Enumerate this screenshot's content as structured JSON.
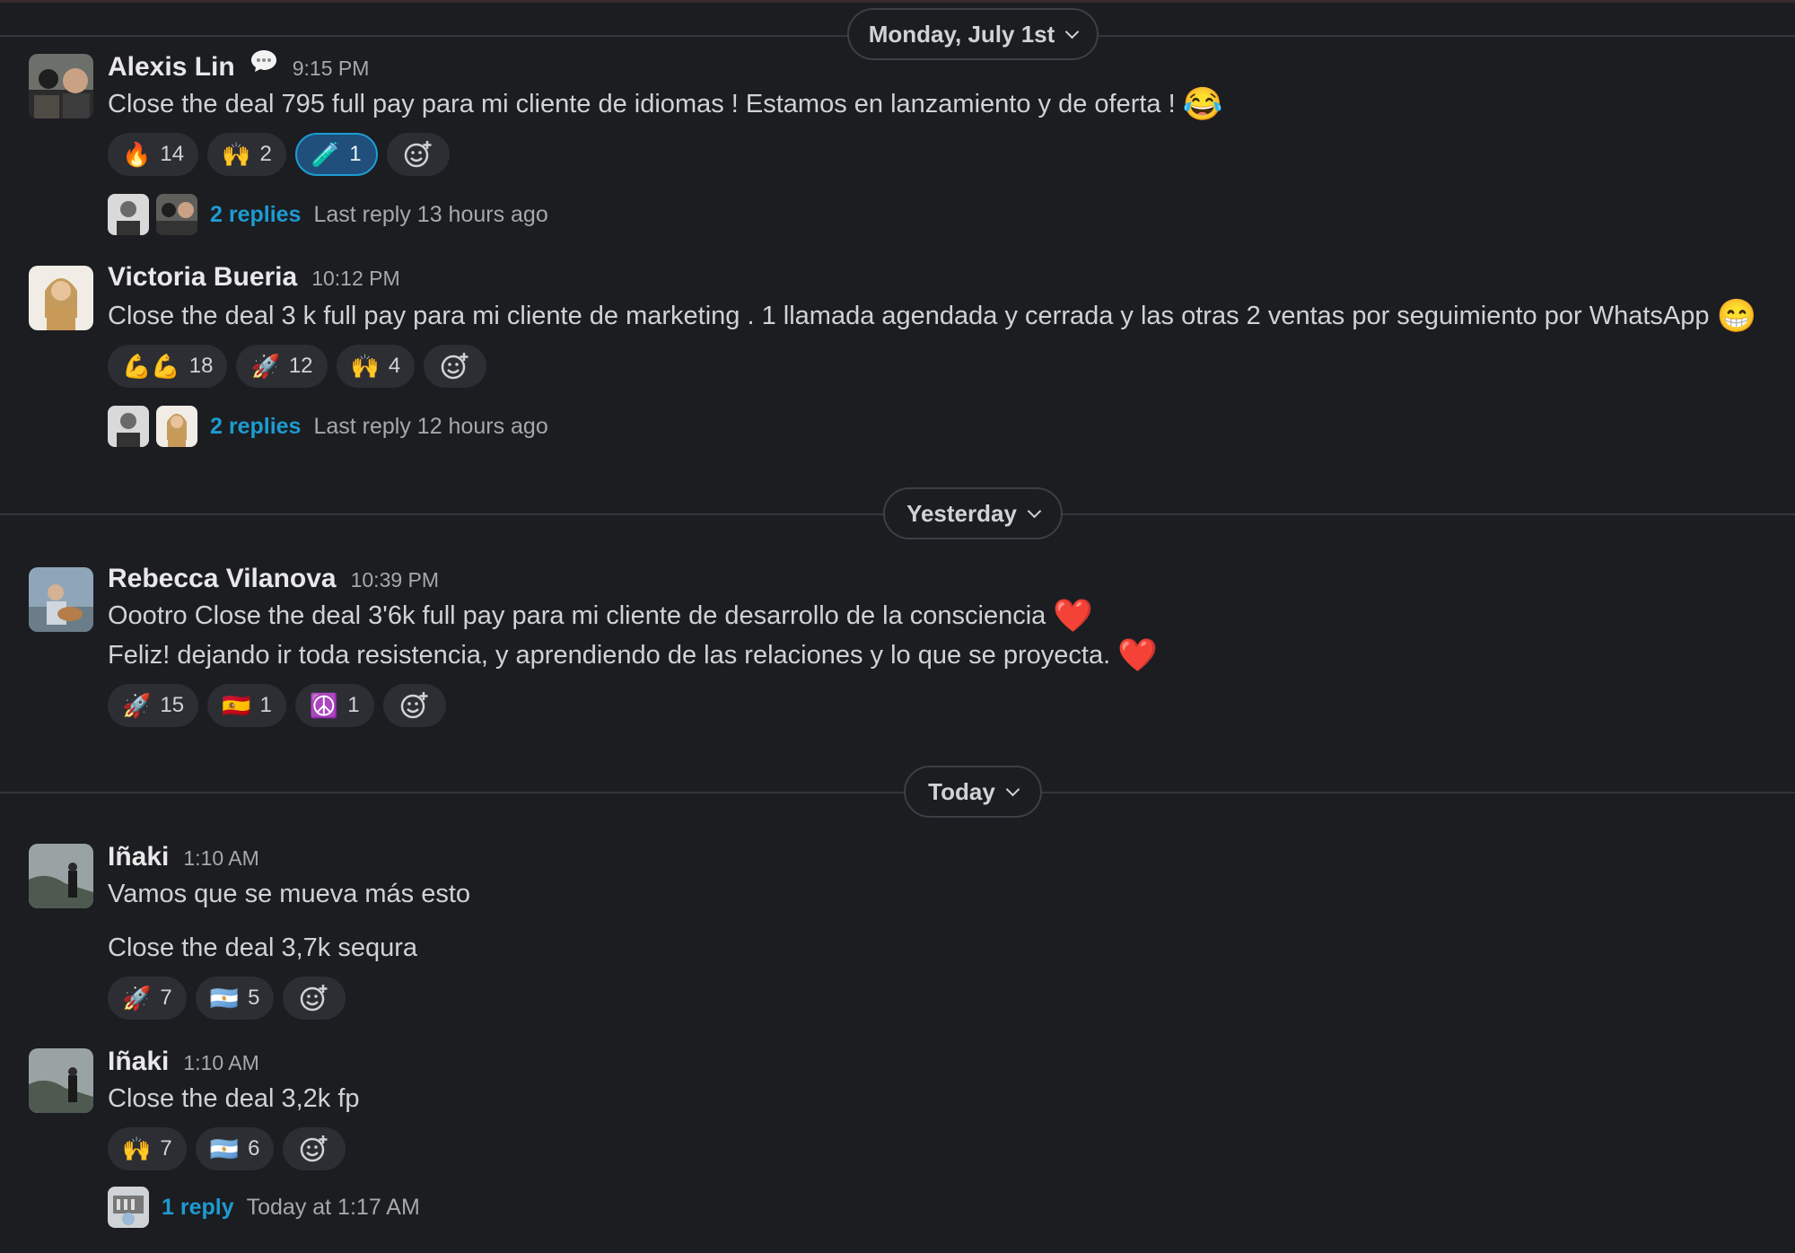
{
  "dividers": {
    "d1": "Monday, July 1st",
    "d2": "Yesterday",
    "d3": "Today"
  },
  "m1": {
    "author": "Alexis Lin",
    "time": "9:15 PM",
    "text": "Close the deal 795 full pay para mi cliente de idiomas ! Estamos en lanzamiento y de oferta !",
    "trailing_emoji": "😂",
    "reactions": [
      {
        "emoji": "🔥",
        "count": "14"
      },
      {
        "emoji": "🙌",
        "count": "2"
      },
      {
        "emoji": "🧪",
        "count": "1"
      }
    ],
    "thread": {
      "replies": "2 replies",
      "last": "Last reply 13 hours ago"
    }
  },
  "m2": {
    "author": "Victoria Bueria",
    "time": "10:12 PM",
    "text": "Close the deal 3 k full pay para mi cliente de marketing . 1 llamada agendada y cerrada y las otras 2 ventas por seguimiento por WhatsApp",
    "trailing_emoji": "😁",
    "reactions": [
      {
        "emoji": "💪💪",
        "count": "18"
      },
      {
        "emoji": "🚀",
        "count": "12"
      },
      {
        "emoji": "🙌",
        "count": "4"
      }
    ],
    "thread": {
      "replies": "2 replies",
      "last": "Last reply 12 hours ago"
    }
  },
  "m3": {
    "author": "Rebecca Vilanova",
    "time": "10:39 PM",
    "line1": "Oootro Close the deal 3'6k full pay para mi cliente de desarrollo de la consciencia",
    "line2": "Feliz! dejando ir toda resistencia, y aprendiendo de las relaciones y lo que se proyecta.",
    "heart": "❤️",
    "reactions": [
      {
        "emoji": "🚀",
        "count": "15"
      },
      {
        "emoji": "🇪🇸",
        "count": "1"
      },
      {
        "emoji": "☮️",
        "count": "1"
      }
    ]
  },
  "m4": {
    "author": "Iñaki",
    "time": "1:10 AM",
    "line1": "Vamos que se mueva más esto",
    "line2": "Close the deal 3,7k sequra",
    "reactions": [
      {
        "emoji": "🚀",
        "count": "7"
      },
      {
        "emoji": "🇦🇷",
        "count": "5"
      }
    ]
  },
  "m5": {
    "author": "Iñaki",
    "time": "1:10 AM",
    "text": "Close the deal 3,2k fp",
    "reactions": [
      {
        "emoji": "🙌",
        "count": "7"
      },
      {
        "emoji": "🇦🇷",
        "count": "6"
      }
    ],
    "thread": {
      "replies": "1 reply",
      "last": "Today at 1:17 AM"
    }
  },
  "icons": {
    "add_reaction": "add-reaction-icon",
    "chevron": "chevron-down-icon",
    "chat_bubble": "chat-bubble-icon"
  }
}
